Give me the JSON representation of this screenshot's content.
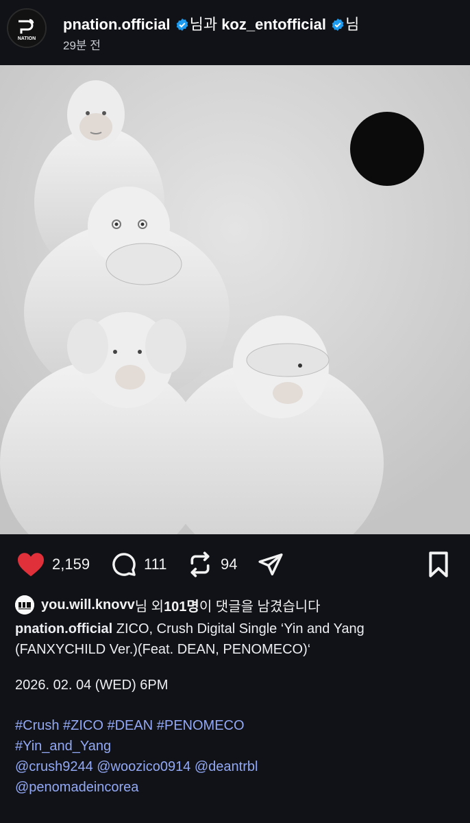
{
  "header": {
    "account1": "pnation.official",
    "join_text": "님과",
    "account2": "koz_entofficial",
    "suffix_text": "님",
    "time_ago": "29분 전",
    "avatar_logo_text": "NATION"
  },
  "post": {
    "image_alt": "Four white monkeys in see-no-evil, hear-no-evil, speak-no-evil poses with a black circle",
    "likes": "2,159",
    "comments": "111",
    "reposts": "94",
    "liked": true,
    "accent_like_color": "#e0303a"
  },
  "comments_summary": {
    "user": "you.will.knovv",
    "text_mid": "님 외 ",
    "count": "101명",
    "text_end": "이 댓글을 남겼습니다"
  },
  "caption": {
    "author": "pnation.official",
    "line1_rest": " ZICO, Crush Digital Single ‘Yin and Yang",
    "line2": "(FANXYCHILD Ver.)(Feat. DEAN, PENOMECO)‘",
    "date": "2026. 02. 04 (WED) 6PM",
    "hashtags_line1": "#Crush #ZICO #DEAN #PENOMECO",
    "hashtags_line2": "#Yin_and_Yang",
    "mentions_line1": "@crush9244 @woozico0914 @deantrbl",
    "mentions_line2": "@penomadeincorea",
    "link_color": "#93a9f5"
  }
}
